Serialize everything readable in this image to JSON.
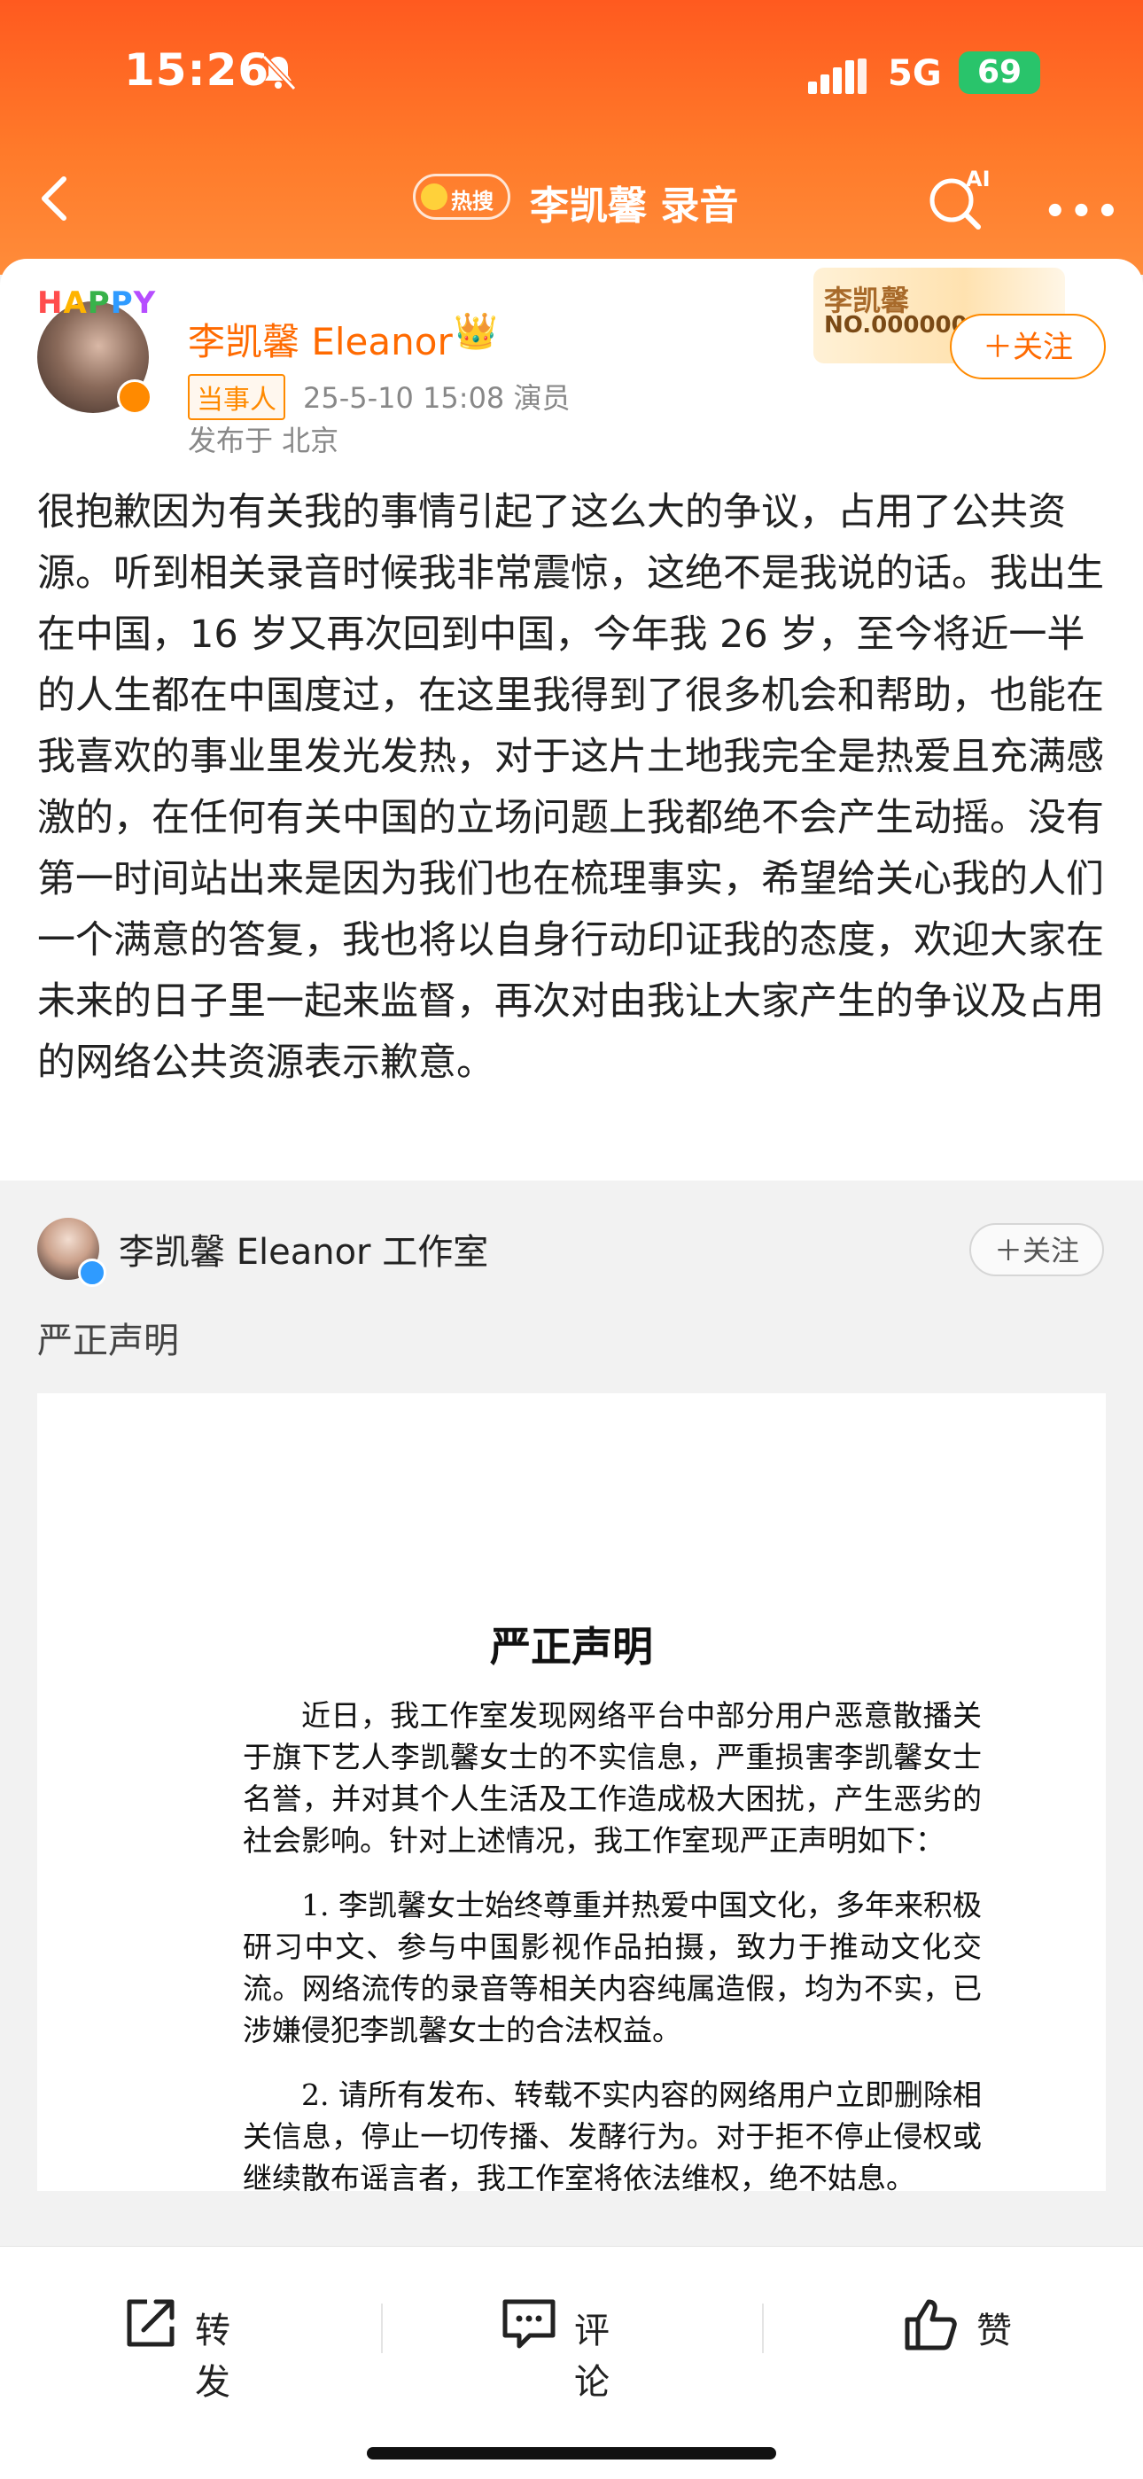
{
  "status_bar": {
    "time": "15:26",
    "network": "5G",
    "battery": "69"
  },
  "nav": {
    "hot_label": "热搜",
    "title": "李凯馨 录音",
    "ai_label": "AI"
  },
  "post": {
    "username": "李凯馨 Eleanor",
    "avatar_text": "HAPPY",
    "tag": "当事人",
    "meta": "25-5-10 15:08  演员",
    "location": "发布于 北京",
    "fan_card_name": "李凯馨",
    "fan_card_no": "NO.000000",
    "follow_label": "＋关注",
    "text": "很抱歉因为有关我的事情引起了这么大的争议，占用了公共资源。听到相关录音时候我非常震惊，这绝不是我说的话。我出生在中国，16 岁又再次回到中国，今年我 26 岁，至今将近一半的人生都在中国度过，在这里我得到了很多机会和帮助，也能在我喜欢的事业里发光发热，对于这片土地我完全是热爱且充满感激的，在任何有关中国的立场问题上我都绝不会产生动摇。没有第一时间站出来是因为我们也在梳理事实，希望给关心我的人们一个满意的答复，我也将以自身行动印证我的态度，欢迎大家在未来的日子里一起来监督，再次对由我让大家产生的争议及占用的网络公共资源表示歉意。"
  },
  "repost": {
    "username": "李凯馨 Eleanor 工作室",
    "follow_label": "＋关注",
    "text": "严正声明",
    "document": {
      "title": "严正声明",
      "para1": "近日，我工作室发现网络平台中部分用户恶意散播关于旗下艺人李凯馨女士的不实信息，严重损害李凯馨女士名誉，并对其个人生活及工作造成极大困扰，产生恶劣的社会影响。针对上述情况，我工作室现严正声明如下：",
      "item1": "1. 李凯馨女士始终尊重并热爱中国文化，多年来积极研习中文、参与中国影视作品拍摄，致力于推动文化交流。网络流传的录音等相关内容纯属造假，均为不实，已涉嫌侵犯李凯馨女士的合法权益。",
      "item2": "2. 请所有发布、转载不实内容的网络用户立即删除相关信息，停止一切传播、发酵行为。对于拒不停止侵权或继续散布谣言者，我工作室将依法维权，绝不姑息。"
    }
  },
  "actions": {
    "repost": "转发",
    "comment": "评论",
    "like": "赞"
  },
  "colors": {
    "accent": "#ff6a00",
    "header_start": "#ff5a1f",
    "header_end": "#ff8c3a",
    "battery": "#29c46b"
  }
}
